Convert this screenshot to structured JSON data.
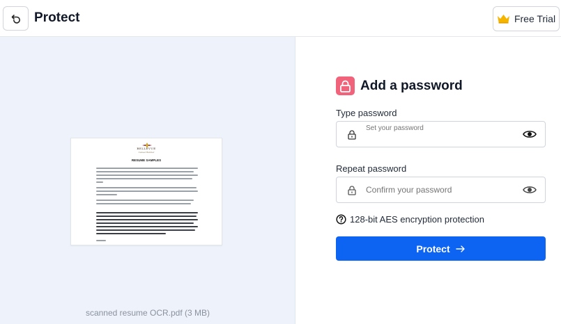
{
  "header": {
    "title": "Protect",
    "back_icon": "undo-icon",
    "trial_label": "Free Trial",
    "trial_icon": "crown-icon",
    "crown_color": "#f5b400"
  },
  "preview": {
    "file_caption": "scanned resume OCR.pdf (3 MB)",
    "doc_brand": "BELLEVUE",
    "doc_subtitle": "Career Builder",
    "doc_heading": "RESUME SAMPLES"
  },
  "form": {
    "title": "Add a password",
    "lock_badge_color": "#f0637a",
    "password_label": "Type password",
    "password_placeholder": "Set your password",
    "repeat_label": "Repeat password",
    "repeat_placeholder": "Confirm your password",
    "encryption_note": "128-bit AES encryption protection",
    "submit_label": "Protect",
    "submit_color": "#0d63f2"
  }
}
